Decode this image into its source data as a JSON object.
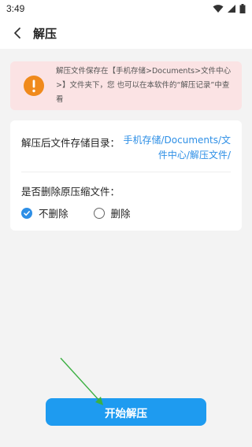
{
  "status_bar": {
    "time": "3:49"
  },
  "app_bar": {
    "title": "解压"
  },
  "notice": {
    "text": "解压文件保存在【手机存储>Documents>文件中心>】文件夹下，您 也可以在本软件的“解压记录”中查看",
    "icon": "warning-icon",
    "color": "#fbe3e4"
  },
  "settings": {
    "storage_label": "解压后文件存储目录：",
    "storage_path": "手机存储/Documents/文件中心/解压文件/",
    "delete_label": "是否删除原压缩文件：",
    "options": [
      {
        "label": "不删除",
        "selected": true
      },
      {
        "label": "删除",
        "selected": false
      }
    ]
  },
  "actions": {
    "start_label": "开始解压"
  },
  "colors": {
    "accent": "#1e9bf0",
    "link": "#2e8fe6",
    "warning": "#f08a1c"
  }
}
